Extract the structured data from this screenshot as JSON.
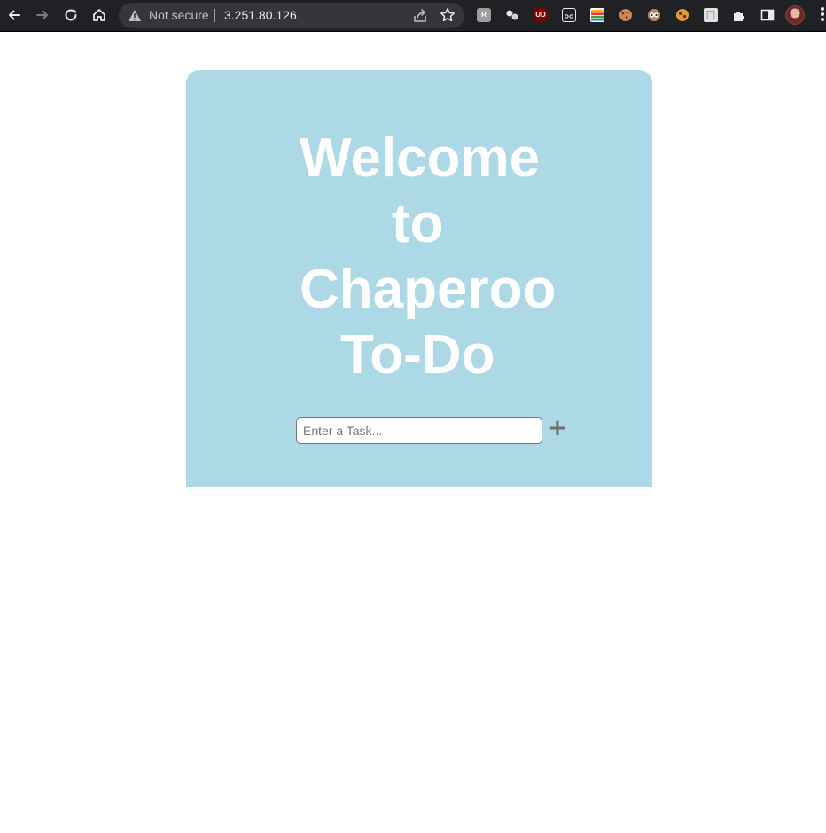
{
  "browser": {
    "security_label": "Not secure",
    "url": "3.251.80.126",
    "extensions": [
      {
        "name": "readwise",
        "glyph": "R",
        "bg": "#9e9e9e",
        "fg": "#ffffff"
      },
      {
        "name": "ublock",
        "glyph": "UD",
        "bg": "#800000",
        "fg": "#ffffff"
      }
    ],
    "colors": {
      "toolbar": "#202124",
      "omnibox": "#35363a"
    }
  },
  "page": {
    "title_lines": [
      "Welcome",
      "to",
      "Chaperoo",
      "To-Do"
    ],
    "task_input": {
      "placeholder": "Enter a Task...",
      "value": ""
    },
    "add_button_label": "+",
    "colors": {
      "card_background": "#add8e6",
      "title_text": "#ffffff",
      "add_button": "#6e6e6e"
    }
  }
}
